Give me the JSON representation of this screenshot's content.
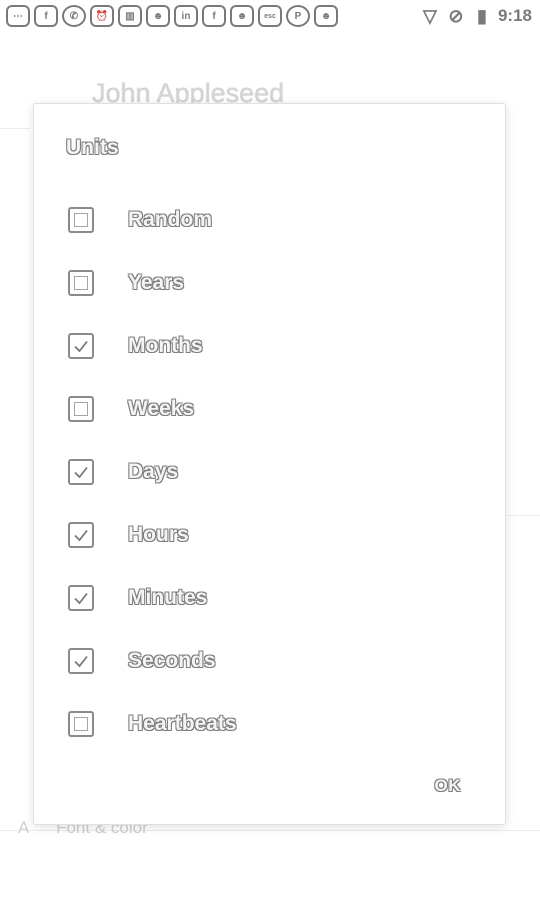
{
  "status_bar": {
    "icons": [
      {
        "name": "messages-icon",
        "glyph": "⋯"
      },
      {
        "name": "facebook-icon",
        "glyph": "f"
      },
      {
        "name": "whatsapp-icon",
        "glyph": "✆"
      },
      {
        "name": "alarm-icon",
        "glyph": "⏰"
      },
      {
        "name": "sd-card-icon",
        "glyph": "▥"
      },
      {
        "name": "wolf-icon",
        "glyph": "☻"
      },
      {
        "name": "linkedin-icon",
        "glyph": "in"
      },
      {
        "name": "facebook-icon",
        "glyph": "f"
      },
      {
        "name": "wolf-icon",
        "glyph": "☻"
      },
      {
        "name": "esc-icon",
        "glyph": "esc"
      },
      {
        "name": "pinterest-icon",
        "glyph": "P"
      },
      {
        "name": "wolf-icon",
        "glyph": "☻"
      }
    ],
    "right_icons": [
      {
        "name": "wifi-icon",
        "glyph": "▽"
      },
      {
        "name": "no-sim-icon",
        "glyph": "⊘"
      },
      {
        "name": "battery-icon",
        "glyph": "▮"
      }
    ],
    "time": "9:18"
  },
  "background": {
    "title": "John Appleseed",
    "bottom_icon": "A",
    "bottom_text": "Font & color"
  },
  "dialog": {
    "title": "Units",
    "options": [
      {
        "label": "Random",
        "checked": false
      },
      {
        "label": "Years",
        "checked": false
      },
      {
        "label": "Months",
        "checked": true
      },
      {
        "label": "Weeks",
        "checked": false
      },
      {
        "label": "Days",
        "checked": true
      },
      {
        "label": "Hours",
        "checked": true
      },
      {
        "label": "Minutes",
        "checked": true
      },
      {
        "label": "Seconds",
        "checked": true
      },
      {
        "label": "Heartbeats",
        "checked": false
      }
    ],
    "ok_label": "OK"
  }
}
